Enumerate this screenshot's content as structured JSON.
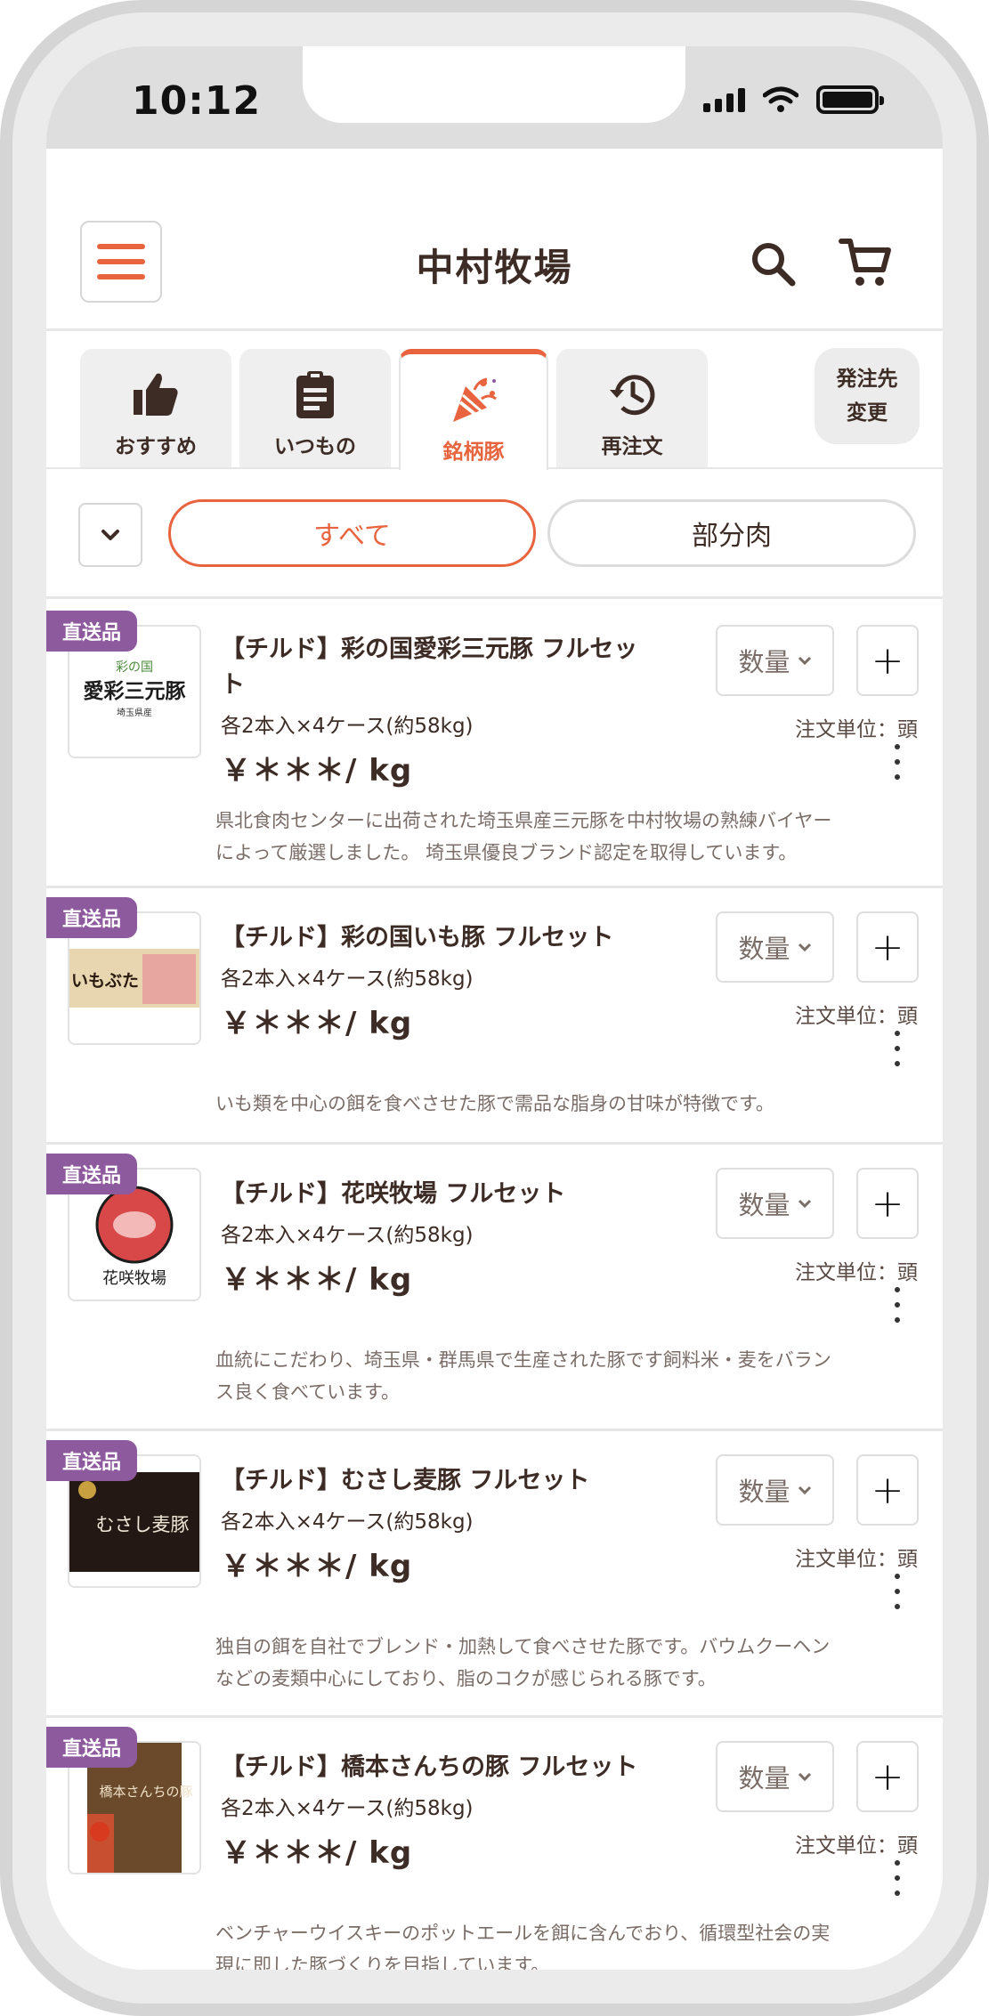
{
  "status_bar": {
    "time": "10:12"
  },
  "header": {
    "title": "中村牧場",
    "menu_icon": "hamburger-icon",
    "search_icon": "search-icon",
    "cart_icon": "cart-icon"
  },
  "tabs": [
    {
      "label": "おすすめ",
      "icon": "thumbs-up-icon",
      "active": false
    },
    {
      "label": "いつもの",
      "icon": "clipboard-icon",
      "active": false
    },
    {
      "label": "銘柄豚",
      "icon": "party-popper-icon",
      "active": true
    },
    {
      "label": "再注文",
      "icon": "history-icon",
      "active": false
    }
  ],
  "order_destination": {
    "line1": "発注先",
    "line2": "変更"
  },
  "filters": {
    "all": "すべて",
    "cuts": "部分肉"
  },
  "colors": {
    "accent": "#e8643e",
    "badge": "#8e5a9e",
    "text": "#3d2c25"
  },
  "products": [
    {
      "badge": "直送品",
      "name_line1": "【チルド】彩の国愛彩三元豚 フルセッ",
      "name_line2": "ト",
      "spec": "各2本入×4ケース(約58kg)",
      "price": "￥＊＊＊/ kg",
      "qty_label": "数量",
      "unit": "注文単位：頭",
      "desc_line1": "県北食肉センターに出荷された埼玉県産三元豚を中村牧場の熟練バイヤー",
      "desc_line2": "によって厳選しました。 埼玉県優良ブランド認定を取得しています。",
      "thumb": {
        "top": "彩の国",
        "main": "愛彩三元豚",
        "sub": "埼玉県産"
      }
    },
    {
      "badge": "直送品",
      "name_line1": "【チルド】彩の国いも豚 フルセット",
      "name_line2": "",
      "spec": "各2本入×4ケース(約58kg)",
      "price": "￥＊＊＊/ kg",
      "qty_label": "数量",
      "unit": "注文単位：頭",
      "desc_line1": "いも類を中心の餌を食べさせた豚で需品な脂身の甘味が特徴です。",
      "desc_line2": "",
      "thumb": {
        "main": "いもぶた"
      }
    },
    {
      "badge": "直送品",
      "name_line1": "【チルド】花咲牧場 フルセット",
      "name_line2": "",
      "spec": "各2本入×4ケース(約58kg)",
      "price": "￥＊＊＊/ kg",
      "qty_label": "数量",
      "unit": "注文単位：頭",
      "desc_line1": "血統にこだわり、埼玉県・群馬県で生産された豚です飼料米・麦をバラン",
      "desc_line2": "ス良く食べています。",
      "thumb": {
        "main": "花咲牧場"
      }
    },
    {
      "badge": "直送品",
      "name_line1": "【チルド】むさし麦豚 フルセット",
      "name_line2": "",
      "spec": "各2本入×4ケース(約58kg)",
      "price": "￥＊＊＊/ kg",
      "qty_label": "数量",
      "unit": "注文単位：頭",
      "desc_line1": "独自の餌を自社でブレンド・加熱して食べさせた豚です。バウムクーヘン",
      "desc_line2": "などの麦類中心にしており、脂のコクが感じられる豚です。",
      "thumb": {
        "main": "むさし麦豚"
      }
    },
    {
      "badge": "直送品",
      "name_line1": "【チルド】橋本さんちの豚 フルセット",
      "name_line2": "",
      "spec": "各2本入×4ケース(約58kg)",
      "price": "￥＊＊＊/ kg",
      "qty_label": "数量",
      "unit": "注文単位：頭",
      "desc_line1": "ベンチャーウイスキーのポットエールを餌に含んでおり、循環型社会の実",
      "desc_line2": "現に即した豚づくりを目指しています。",
      "thumb": {
        "main": "橋本さんちの豚"
      }
    }
  ]
}
